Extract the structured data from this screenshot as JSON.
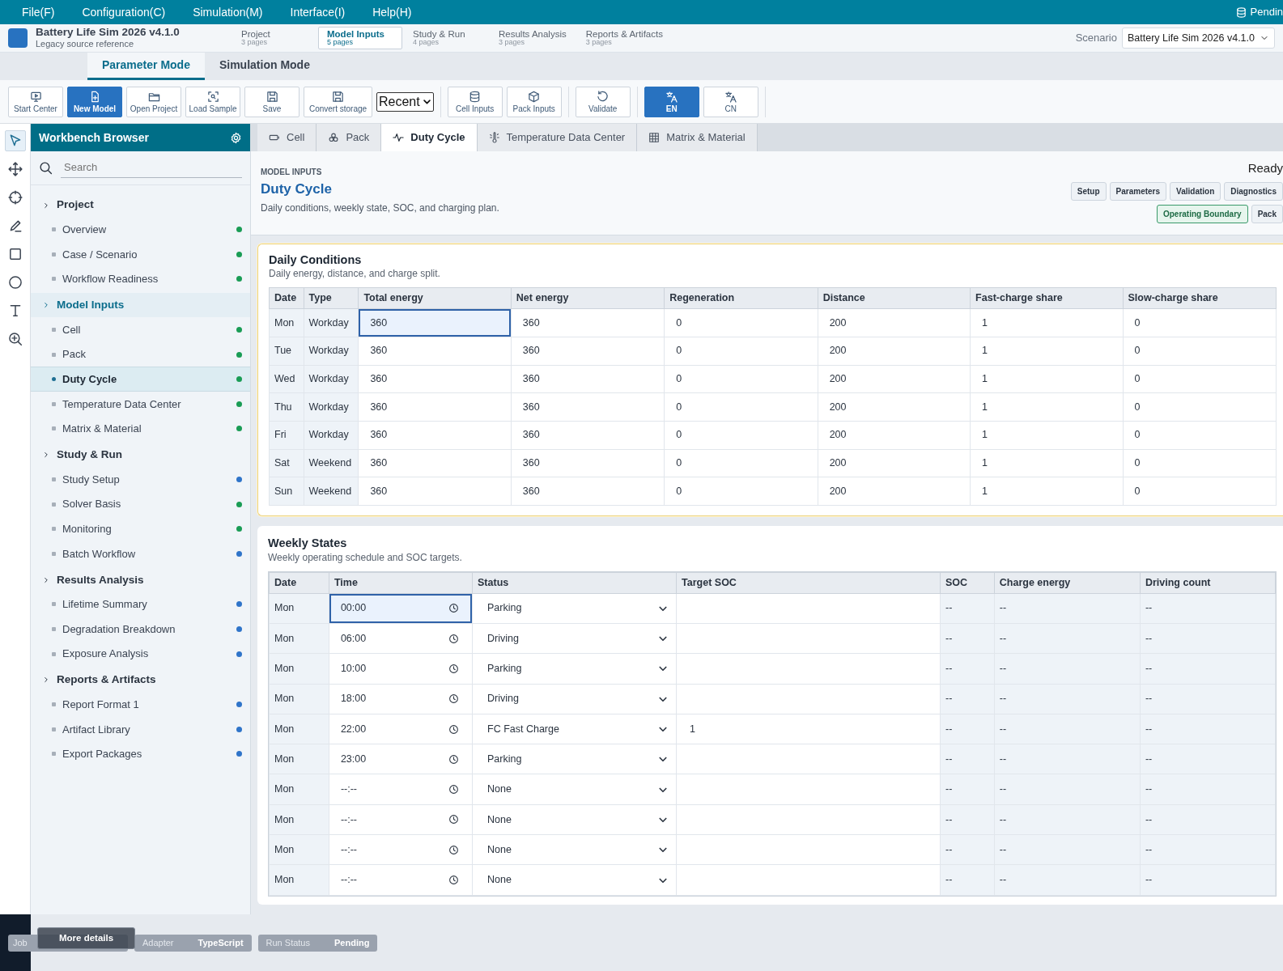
{
  "menu": [
    "File(F)",
    "Configuration(C)",
    "Simulation(M)",
    "Interface(I)",
    "Help(H)"
  ],
  "connection": "Pendin",
  "app": {
    "title": "Battery Life Sim 2026 v4.1.0",
    "subtitle": "Legacy source reference"
  },
  "sections": [
    {
      "label": "Project",
      "pages": "3 pages",
      "selected": false
    },
    {
      "label": "Model Inputs",
      "pages": "5 pages",
      "selected": true
    },
    {
      "label": "Study & Run",
      "pages": "4 pages",
      "selected": false
    },
    {
      "label": "Results Analysis",
      "pages": "3 pages",
      "selected": false
    },
    {
      "label": "Reports & Artifacts",
      "pages": "3 pages",
      "selected": false
    }
  ],
  "scenario": {
    "label": "Scenario",
    "value": "Battery Life Sim 2026 v4.1.0"
  },
  "modes": [
    {
      "label": "Parameter Mode",
      "selected": true
    },
    {
      "label": "Simulation Mode",
      "selected": false
    }
  ],
  "toolbar": [
    {
      "items": [
        {
          "kind": "button",
          "label": "Start Center",
          "selected": false
        },
        {
          "kind": "button",
          "label": "New Model",
          "selected": true
        },
        {
          "kind": "button",
          "label": "Open Project",
          "selected": false
        },
        {
          "kind": "button",
          "label": "Load Sample",
          "selected": false
        },
        {
          "kind": "button",
          "label": "Save",
          "selected": false
        },
        {
          "kind": "button",
          "label": "Convert storage",
          "selected": false
        },
        {
          "kind": "select",
          "label": "Recent"
        }
      ]
    },
    {
      "items": [
        {
          "kind": "button",
          "label": "Cell Inputs",
          "selected": false
        },
        {
          "kind": "button",
          "label": "Pack Inputs",
          "selected": false
        }
      ]
    },
    {
      "items": [
        {
          "kind": "button",
          "label": "Validate",
          "selected": false
        }
      ]
    },
    {
      "items": [
        {
          "kind": "button",
          "label": "EN",
          "selected": true
        },
        {
          "kind": "button",
          "label": "CN",
          "selected": false
        }
      ]
    }
  ],
  "tools": [
    {
      "selected": true
    },
    {
      "selected": false
    },
    {
      "selected": false
    },
    {
      "selected": false
    },
    {
      "selected": false
    },
    {
      "selected": false
    },
    {
      "selected": false
    },
    {
      "selected": false
    }
  ],
  "sidebar": {
    "title": "Workbench Browser",
    "search_placeholder": "Search",
    "groups": [
      {
        "label": "Project",
        "selected": false,
        "children": [
          {
            "label": "Overview",
            "selected": false,
            "color": "#1a9c55"
          },
          {
            "label": "Case / Scenario",
            "selected": false,
            "color": "#1a9c55"
          },
          {
            "label": "Workflow Readiness",
            "selected": false,
            "color": "#1a9c55"
          }
        ]
      },
      {
        "label": "Model Inputs",
        "selected": true,
        "children": [
          {
            "label": "Cell",
            "selected": false,
            "color": "#1a9c55"
          },
          {
            "label": "Pack",
            "selected": false,
            "color": "#1a9c55"
          },
          {
            "label": "Duty Cycle",
            "selected": true,
            "color": "#1a9c55"
          },
          {
            "label": "Temperature Data Center",
            "selected": false,
            "color": "#1a9c55"
          },
          {
            "label": "Matrix & Material",
            "selected": false,
            "color": "#1a9c55"
          }
        ]
      },
      {
        "label": "Study & Run",
        "selected": false,
        "children": [
          {
            "label": "Study Setup",
            "selected": false,
            "color": "#2f74c9"
          },
          {
            "label": "Solver Basis",
            "selected": false,
            "color": "#1a9c55"
          },
          {
            "label": "Monitoring",
            "selected": false,
            "color": "#1a9c55"
          },
          {
            "label": "Batch Workflow",
            "selected": false,
            "color": "#2f74c9"
          }
        ]
      },
      {
        "label": "Results Analysis",
        "selected": false,
        "children": [
          {
            "label": "Lifetime Summary",
            "selected": false,
            "color": "#2f74c9"
          },
          {
            "label": "Degradation Breakdown",
            "selected": false,
            "color": "#2f74c9"
          },
          {
            "label": "Exposure Analysis",
            "selected": false,
            "color": "#2f74c9"
          }
        ]
      },
      {
        "label": "Reports & Artifacts",
        "selected": false,
        "children": [
          {
            "label": "Report Format 1",
            "selected": false,
            "color": "#2f74c9"
          },
          {
            "label": "Artifact Library",
            "selected": false,
            "color": "#2f74c9"
          },
          {
            "label": "Export Packages",
            "selected": false,
            "color": "#2f74c9"
          }
        ]
      }
    ]
  },
  "tabs": [
    {
      "label": "Cell",
      "selected": false
    },
    {
      "label": "Pack",
      "selected": false
    },
    {
      "label": "Duty Cycle",
      "selected": true
    },
    {
      "label": "Temperature Data Center",
      "selected": false
    },
    {
      "label": "Matrix & Material",
      "selected": false
    }
  ],
  "page": {
    "eyebrow": "MODEL INPUTS",
    "title": "Duty Cycle",
    "description": "Daily conditions, weekly state, SOC, and charging plan.",
    "status": "Ready",
    "chips": [
      "Setup",
      "Parameters",
      "Validation",
      "Diagnostics"
    ],
    "filters": [
      {
        "label": "Operating Boundary",
        "selected": true
      },
      {
        "label": "Pack",
        "selected": false
      }
    ]
  },
  "daily": {
    "title": "Daily Conditions",
    "subtitle": "Daily energy, distance, and charge split.",
    "columns": [
      "Date",
      "Type",
      "Total energy",
      "Net energy",
      "Regeneration",
      "Distance",
      "Fast-charge share",
      "Slow-charge share"
    ],
    "rows": [
      {
        "selected": true,
        "cells": [
          "Mon",
          "Workday",
          "360",
          "360",
          "0",
          "200",
          "1",
          "0"
        ]
      },
      {
        "selected": false,
        "cells": [
          "Tue",
          "Workday",
          "360",
          "360",
          "0",
          "200",
          "1",
          "0"
        ]
      },
      {
        "selected": false,
        "cells": [
          "Wed",
          "Workday",
          "360",
          "360",
          "0",
          "200",
          "1",
          "0"
        ]
      },
      {
        "selected": false,
        "cells": [
          "Thu",
          "Workday",
          "360",
          "360",
          "0",
          "200",
          "1",
          "0"
        ]
      },
      {
        "selected": false,
        "cells": [
          "Fri",
          "Workday",
          "360",
          "360",
          "0",
          "200",
          "1",
          "0"
        ]
      },
      {
        "selected": false,
        "cells": [
          "Sat",
          "Weekend",
          "360",
          "360",
          "0",
          "200",
          "1",
          "0"
        ]
      },
      {
        "selected": false,
        "cells": [
          "Sun",
          "Weekend",
          "360",
          "360",
          "0",
          "200",
          "1",
          "0"
        ]
      }
    ]
  },
  "weekly": {
    "title": "Weekly States",
    "subtitle": "Weekly operating schedule and SOC targets.",
    "columns": [
      "Date",
      "Time",
      "Status",
      "Target SOC",
      "SOC",
      "Charge energy",
      "Driving count"
    ],
    "rows": [
      {
        "selected": true,
        "date": "Mon",
        "time": "00:00",
        "status": "Parking",
        "soc": "--",
        "charge_energy": "--",
        "driving_count": "--"
      },
      {
        "selected": false,
        "date": "Mon",
        "time": "06:00",
        "status": "Driving",
        "soc": "--",
        "charge_energy": "--",
        "driving_count": "--"
      },
      {
        "selected": false,
        "date": "Mon",
        "time": "10:00",
        "status": "Parking",
        "soc": "--",
        "charge_energy": "--",
        "driving_count": "--"
      },
      {
        "selected": false,
        "date": "Mon",
        "time": "18:00",
        "status": "Driving",
        "soc": "--",
        "charge_energy": "--",
        "driving_count": "--"
      },
      {
        "selected": false,
        "date": "Mon",
        "time": "22:00",
        "status": "FC Fast Charge",
        "target_soc": "1",
        "soc": "--",
        "charge_energy": "--",
        "driving_count": "--"
      },
      {
        "selected": false,
        "date": "Mon",
        "time": "23:00",
        "status": "Parking",
        "soc": "--",
        "charge_energy": "--",
        "driving_count": "--"
      },
      {
        "selected": false,
        "date": "Mon",
        "time": "--:--",
        "status": "None",
        "soc": "--",
        "charge_energy": "--",
        "driving_count": "--"
      },
      {
        "selected": false,
        "date": "Mon",
        "time": "--:--",
        "status": "None",
        "soc": "--",
        "charge_energy": "--",
        "driving_count": "--"
      },
      {
        "selected": false,
        "date": "Mon",
        "time": "--:--",
        "status": "None",
        "soc": "--",
        "charge_energy": "--",
        "driving_count": "--"
      },
      {
        "selected": false,
        "date": "Mon",
        "time": "--:--",
        "status": "None",
        "soc": "--",
        "charge_energy": "--",
        "driving_count": "--"
      }
    ]
  },
  "footer": {
    "pills": [
      {
        "label": "Job"
      },
      {
        "label": "Adapter",
        "value": "TypeScript"
      },
      {
        "label": "Run Status",
        "value": "Pending"
      }
    ],
    "tooltip": "More details"
  }
}
